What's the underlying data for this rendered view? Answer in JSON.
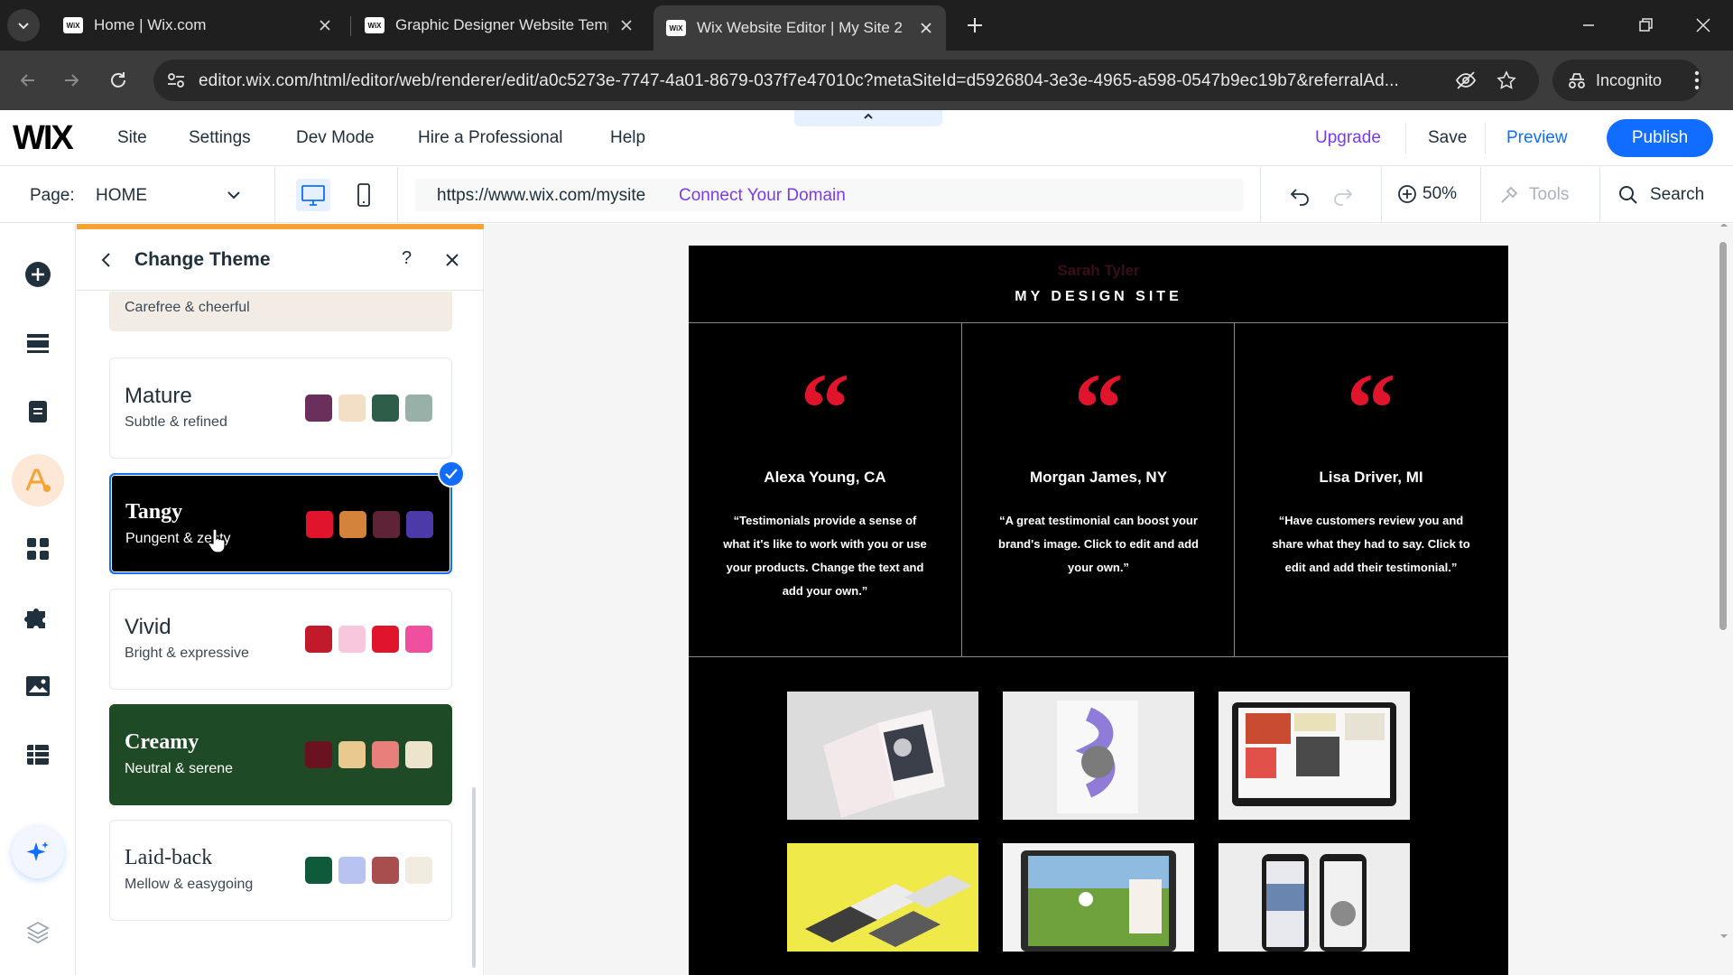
{
  "browser": {
    "tabs": [
      {
        "label": "Home | Wix.com",
        "active": false
      },
      {
        "label": "Graphic Designer Website Temp",
        "active": false
      },
      {
        "label": "Wix Website Editor | My Site 2",
        "active": true
      }
    ],
    "favicon_text": "WiX",
    "url": "editor.wix.com/html/editor/web/renderer/edit/a0c5273e-7747-4a01-8679-037f7e47010c?metaSiteId=d5926804-3e3e-4965-a598-0547b9ec19b7&referralAd...",
    "incognito_label": "Incognito"
  },
  "wix_topbar": {
    "logo": "WIX",
    "menu": [
      "Site",
      "Settings",
      "Dev Mode",
      "Hire a Professional",
      "Help"
    ],
    "upgrade": "Upgrade",
    "save": "Save",
    "preview": "Preview",
    "publish": "Publish"
  },
  "pagebar": {
    "page_label": "Page:",
    "page_value": "HOME",
    "site_url": "https://www.wix.com/mysite",
    "connect_domain": "Connect Your Domain",
    "zoom": "50%",
    "tools": "Tools",
    "search": "Search"
  },
  "panel": {
    "title": "Change Theme",
    "help": "?",
    "themes": [
      {
        "name": "",
        "desc": "Carefree & cheerful",
        "colors": [
          "#7a7a72",
          "#c98fd3",
          "#f4f1ec",
          "#f2ec8e"
        ]
      },
      {
        "name": "Mature",
        "desc": "Subtle & refined",
        "colors": [
          "#6b2f5d",
          "#f3dfc5",
          "#2e5d4a",
          "#98b1a8"
        ]
      },
      {
        "name": "Tangy",
        "desc": "Pungent & zesty",
        "colors": [
          "#e0142b",
          "#d4843a",
          "#5e2336",
          "#4c3aa8"
        ],
        "selected": true
      },
      {
        "name": "Vivid",
        "desc": "Bright & expressive",
        "colors": [
          "#c11a2b",
          "#f7c8dd",
          "#e0142b",
          "#ef4f9e"
        ]
      },
      {
        "name": "Creamy",
        "desc": "Neutral & serene",
        "colors": [
          "#6b1220",
          "#e9c98f",
          "#e97f7a",
          "#ece4cc"
        ]
      },
      {
        "name": "Laid-back",
        "desc": "Mellow & easygoing",
        "colors": [
          "#0f5a3b",
          "#b8c3f2",
          "#a84e4e",
          "#f2ebe0"
        ]
      }
    ]
  },
  "site": {
    "owner": "Sarah Tyler",
    "title": "MY DESIGN SITE",
    "quote_glyph": "“",
    "testimonials": [
      {
        "author": "Alexa Young, CA",
        "text": "“Testimonials provide a sense of what it's like to work with you or use your products. Change the text and add your own.”"
      },
      {
        "author": "Morgan James, NY",
        "text": "“A great testimonial can boost your brand's image. Click to edit and add your own.”"
      },
      {
        "author": "Lisa Driver, MI",
        "text": "“Have customers review you and share what they had to say. Click to edit and add their testimonial.”"
      }
    ]
  },
  "colors": {
    "accent": "#116dff",
    "upgrade": "#7c3aed",
    "panel_highlight": "#f7a332",
    "quote_red": "#e0142b"
  }
}
